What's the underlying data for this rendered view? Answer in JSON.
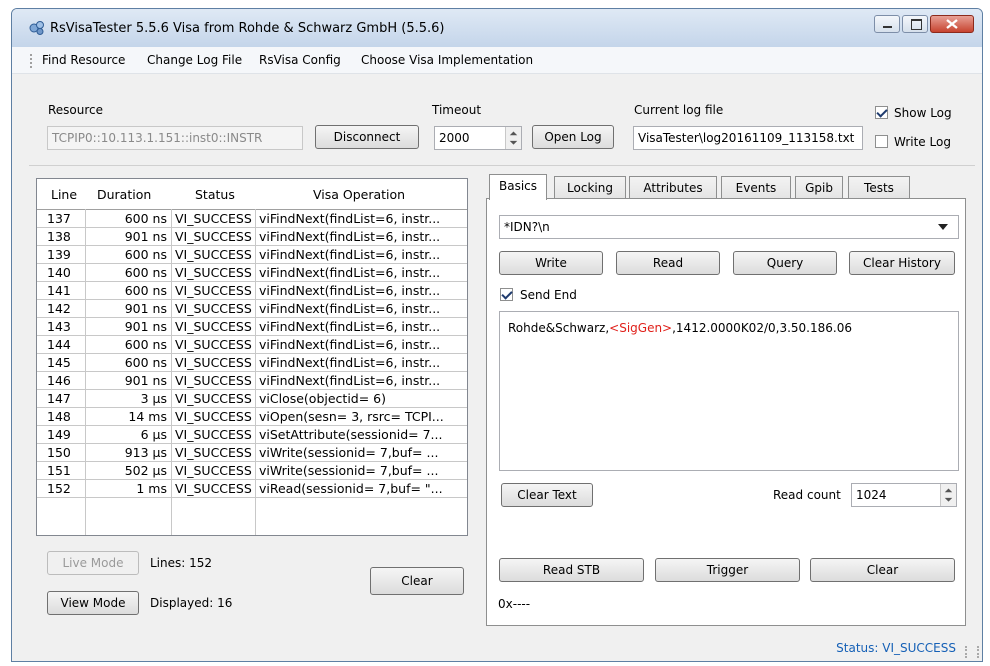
{
  "window": {
    "title": "RsVisaTester 5.5.6 Visa from Rohde & Schwarz GmbH (5.5.6)"
  },
  "menu": [
    "Find Resource",
    "Change Log File",
    "RsVisa Config",
    "Choose Visa Implementation"
  ],
  "resource": {
    "label": "Resource",
    "value": "TCPIP0::10.113.1.151::inst0::INSTR",
    "disconnect_label": "Disconnect",
    "timeout_label": "Timeout",
    "timeout_value": "2000",
    "open_log_label": "Open Log",
    "log_label": "Current log file",
    "log_value": "VisaTester\\log20161109_113158.txt",
    "show_log_label": "Show Log",
    "show_log_checked": true,
    "write_log_label": "Write Log",
    "write_log_checked": false
  },
  "log_table": {
    "headers": [
      "Line",
      "Duration",
      "Status",
      "Visa Operation"
    ],
    "rows": [
      [
        "137",
        "600 ns",
        "VI_SUCCESS",
        "viFindNext(findList=6, instr..."
      ],
      [
        "138",
        "901 ns",
        "VI_SUCCESS",
        "viFindNext(findList=6, instr..."
      ],
      [
        "139",
        "600 ns",
        "VI_SUCCESS",
        "viFindNext(findList=6, instr..."
      ],
      [
        "140",
        "600 ns",
        "VI_SUCCESS",
        "viFindNext(findList=6, instr..."
      ],
      [
        "141",
        "600 ns",
        "VI_SUCCESS",
        "viFindNext(findList=6, instr..."
      ],
      [
        "142",
        "901 ns",
        "VI_SUCCESS",
        "viFindNext(findList=6, instr..."
      ],
      [
        "143",
        "901 ns",
        "VI_SUCCESS",
        "viFindNext(findList=6, instr..."
      ],
      [
        "144",
        "600 ns",
        "VI_SUCCESS",
        "viFindNext(findList=6, instr..."
      ],
      [
        "145",
        "600 ns",
        "VI_SUCCESS",
        "viFindNext(findList=6, instr..."
      ],
      [
        "146",
        "901 ns",
        "VI_SUCCESS",
        "viFindNext(findList=6, instr..."
      ],
      [
        "147",
        "3 µs",
        "VI_SUCCESS",
        "viClose(objectid= 6)"
      ],
      [
        "148",
        "14 ms",
        "VI_SUCCESS",
        "viOpen(sesn= 3, rsrc= TCPI..."
      ],
      [
        "149",
        "6 µs",
        "VI_SUCCESS",
        "viSetAttribute(sessionid= 7..."
      ],
      [
        "150",
        "913 µs",
        "VI_SUCCESS",
        "viWrite(sessionid= 7,buf= ..."
      ],
      [
        "151",
        "502 µs",
        "VI_SUCCESS",
        "viWrite(sessionid= 7,buf= ..."
      ],
      [
        "152",
        "1 ms",
        "VI_SUCCESS",
        "viRead(sessionid= 7,buf= \"..."
      ]
    ]
  },
  "left_controls": {
    "live_mode_label": "Live Mode",
    "view_mode_label": "View Mode",
    "lines_text": "Lines:  152",
    "displayed_text": "Displayed:  16",
    "clear_label": "Clear"
  },
  "tabs": [
    "Basics",
    "Locking",
    "Attributes",
    "Events",
    "Gpib",
    "Tests"
  ],
  "basics": {
    "command": "*IDN?\\n",
    "write_label": "Write",
    "read_label": "Read",
    "query_label": "Query",
    "clear_history_label": "Clear History",
    "send_end_label": "Send End",
    "send_end_checked": true,
    "response_part1": "Rohde&Schwarz,",
    "response_highlight": "<SigGen>",
    "response_part2": ",1412.0000K02/0,3.50.186.06",
    "clear_text_label": "Clear Text",
    "read_count_label": "Read count",
    "read_count_value": "1024",
    "read_stb_label": "Read STB",
    "trigger_label": "Trigger",
    "clear_label": "Clear",
    "stb_value": "0x----"
  },
  "status_text": "Status: VI_SUCCESS",
  "colors": {
    "highlight_red": "#e0201a",
    "status_blue": "#1560b6"
  }
}
